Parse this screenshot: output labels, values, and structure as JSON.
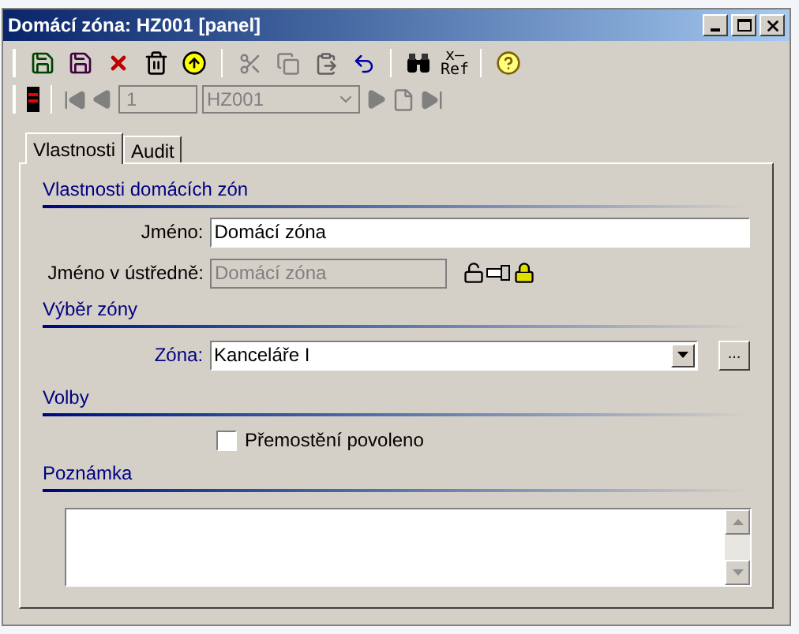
{
  "window": {
    "title": "Domácí zóna: HZ001 [panel]"
  },
  "toolbar": {
    "ref_icon_top": "x–",
    "ref_icon_bottom": "Ref"
  },
  "navigator": {
    "record_number": "1",
    "record_code": "HZ001",
    "disabled": true
  },
  "tabs": [
    {
      "label": "Vlastnosti",
      "selected": true
    },
    {
      "label": "Audit",
      "selected": false
    }
  ],
  "sections": [
    {
      "title": "Vlastnosti domácích zón"
    },
    {
      "title": "Výběr zóny"
    },
    {
      "title": "Volby"
    },
    {
      "title": "Poznámka"
    }
  ],
  "name_field": {
    "label": "Jméno:",
    "value": "Domácí zóna"
  },
  "central_name_field": {
    "label": "Jméno v ústředně:",
    "value": "Domácí zóna",
    "disabled": true
  },
  "zone_field": {
    "label": "Zóna:",
    "value": "Kanceláře I",
    "browse_button": "..."
  },
  "bypass_checkbox": {
    "label": "Přemostění povoleno",
    "checked": false
  }
}
